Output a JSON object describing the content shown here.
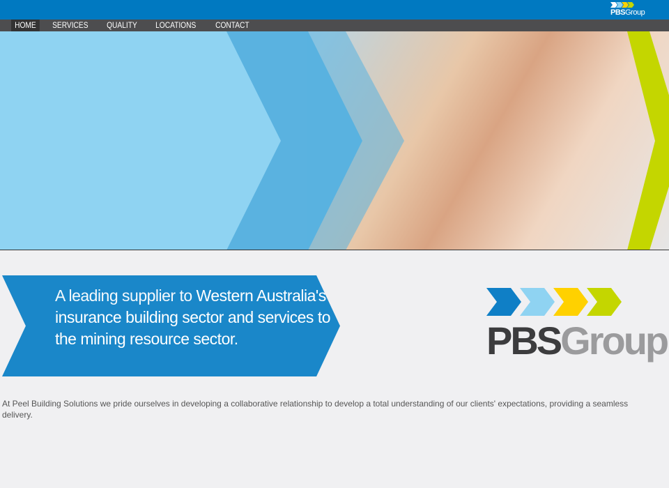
{
  "header": {
    "logo_text_bold": "PBS",
    "logo_text_light": "Group"
  },
  "nav": {
    "items": [
      {
        "label": "HOME",
        "active": true
      },
      {
        "label": "SERVICES"
      },
      {
        "label": "QUALITY"
      },
      {
        "label": "LOCATIONS"
      },
      {
        "label": "CONTACT"
      }
    ]
  },
  "colors": {
    "brand_blue": "#0079c1",
    "nav_bg": "#4d4d4f",
    "banner_blue": "#1a87c9",
    "arrow_colors": [
      "#0f7fc6",
      "#8fd3f2",
      "#ffd100",
      "#c4d600"
    ]
  },
  "hero": {
    "image": "family-photo"
  },
  "banner": {
    "text_light": "A leading supplier to ",
    "text_bold": "Western Australia's insurance building sector and services to the mining resource sector."
  },
  "logo": {
    "bold": "PBS",
    "light": "Group"
  },
  "intro": "At Peel Building Solutions we pride ourselves in developing a collaborative relationship to develop a total understanding of our clients' expectations, providing a seamless delivery."
}
